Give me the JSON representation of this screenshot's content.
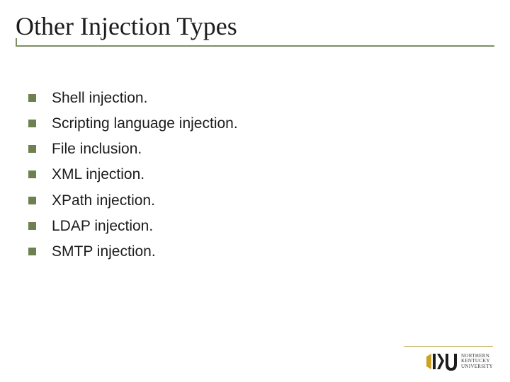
{
  "slide": {
    "title": "Other Injection Types",
    "items": [
      "Shell injection.",
      "Scripting language injection.",
      "File inclusion.",
      "XML injection.",
      "XPath injection.",
      "LDAP injection.",
      "SMTP injection."
    ]
  },
  "footer": {
    "logo_initials": "NKU",
    "logo_text_line1": "NORTHERN",
    "logo_text_line2": "KENTUCKY",
    "logo_text_line3": "UNIVERSITY"
  },
  "colors": {
    "accent": "#7d8f63",
    "bullet": "#6e8050",
    "gold": "#bfa84a",
    "text": "#1c1c1c"
  }
}
